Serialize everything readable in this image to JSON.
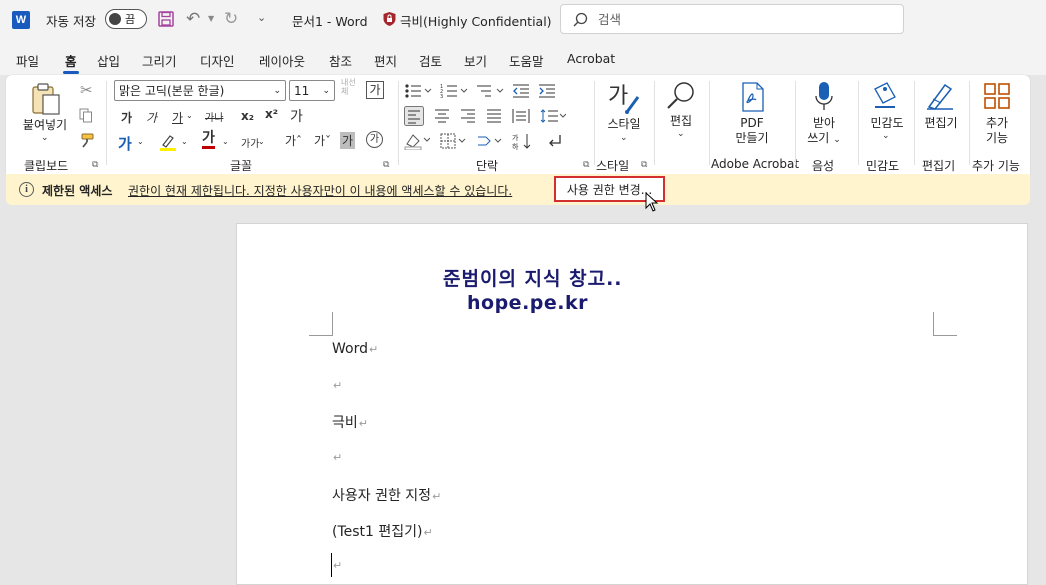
{
  "titlebar": {
    "app_logo": "W",
    "autosave_label": "자동 저장",
    "autosave_state": "끔",
    "doc_title": "문서1  -  Word",
    "sensitivity_label": "극비(Highly Confidential)",
    "search_placeholder": "검색"
  },
  "menu": {
    "tabs": [
      "파일",
      "홈",
      "삽입",
      "그리기",
      "디자인",
      "레이아웃",
      "참조",
      "편지",
      "검토",
      "보기",
      "도움말",
      "Acrobat"
    ],
    "active_tab": "홈"
  },
  "ribbon": {
    "paste_label": "붙여넣기",
    "clipboard_group": "클립보드",
    "font_group": "글꼴",
    "paragraph_group": "단락",
    "styles_group": "스타일",
    "font_name": "맑은 고딕(본문 한글)",
    "font_size": "11",
    "font_tiny_label": "내선\n체",
    "font_buttons": {
      "ga": "가",
      "bold": "가",
      "italic": "가",
      "underline": "가",
      "strike": "가나",
      "sub": "x₂",
      "sup": "x²",
      "clear": "가",
      "highlight_ga": "가",
      "font_color_ga": "가",
      "size_ga": "가가",
      "grow": "가ˆ",
      "shrink": "가ˇ",
      "char_shade": "가",
      "enclose": "가"
    },
    "styles_label": "스타일",
    "styles_glyph": "가",
    "edit_label": "편집",
    "pdf_label_1": "PDF",
    "pdf_label_2": "만들기",
    "adobe_group": "Adobe Acrobat",
    "dictate_label_1": "받아",
    "dictate_label_2": "쓰기",
    "voice_group": "음성",
    "sensitivity_btn": "민감도",
    "sensitivity_group": "민감도",
    "editor_btn": "편집기",
    "editor_group": "편집기",
    "addins_btn_1": "추가",
    "addins_btn_2": "기능",
    "addins_group": "추가 기능"
  },
  "message_bar": {
    "title": "제한된 액세스",
    "text": "권한이 현재 제한됩니다. 지정한 사용자만이 이 내용에 액세스할 수 있습니다.",
    "button": "사용 권한 변경..."
  },
  "document": {
    "watermark_line1": "준범이의 지식 창고..",
    "watermark_line2": "hope.pe.kr",
    "paragraphs": [
      "Word",
      "",
      "극비",
      "",
      "사용자 권한 지정",
      "(Test1 편집기)",
      ""
    ],
    "para_mark": "↵"
  },
  "colors": {
    "accent": "#185abd",
    "message_bg": "#fff4ce",
    "highlight_border": "#d32f2f"
  }
}
